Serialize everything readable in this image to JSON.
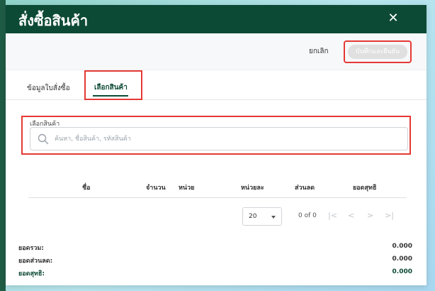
{
  "header": {
    "title": "สั่งซื้อสินค้า",
    "close_glyph": "✕"
  },
  "toolbar": {
    "cancel_label": "ยกเลิก",
    "save_label": "บันทึกและยืนยัน"
  },
  "tabs": [
    {
      "label": "ข้อมูลใบสั่งซื้อ"
    },
    {
      "label": "เลือกสินค้า",
      "active": true
    }
  ],
  "product_search": {
    "label": "เลือกสินค้า",
    "placeholder": "ค้นหา, ชื่อสินค้า, รหัสสินค้า"
  },
  "table": {
    "columns": [
      "ชื่อ",
      "จำนวน",
      "หน่วย",
      "หน่วยละ",
      "ส่วนลด",
      "ยอดสุทธิ"
    ],
    "rows": []
  },
  "pagination": {
    "page_size": "20",
    "count_text": "0 of 0",
    "first": "|<",
    "prev": "<",
    "next": ">",
    "last": ">|"
  },
  "summary": {
    "total_label": "ยอดรวม:",
    "total_value": "0.000",
    "discount_label": "ยอดส่วนลด:",
    "discount_value": "0.000",
    "net_label": "ยอดสุทธิ:",
    "net_value": "0.000"
  },
  "colors": {
    "header_bg": "#0d4a35",
    "accent": "#0d4a35",
    "highlight": "#e53935"
  }
}
